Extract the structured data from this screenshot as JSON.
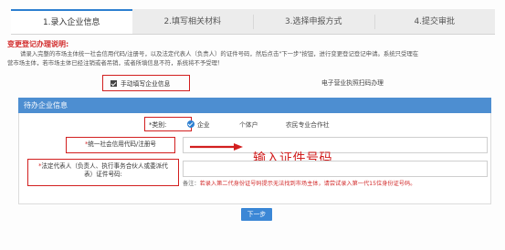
{
  "steps": [
    {
      "label": "1.录入企业信息",
      "active": true
    },
    {
      "label": "2.填写相关材料",
      "active": false
    },
    {
      "label": "3.选择申报方式",
      "active": false
    },
    {
      "label": "4.提交审批",
      "active": false
    }
  ],
  "notice": {
    "title": "变更登记办理说明:",
    "line1": "请录入完整的市场主体统一社会信用代码/注册号，以及法定代表人（负责人）的证件号码，然后点击\"下一步\"按钮，进行变更登记登记申请。系统只受理在",
    "line2": "营市场主体，若市场主体已经注销或者吊销，或者所填信息不符，系统将不予受理！"
  },
  "options": {
    "manual_label": "手动填写企业信息",
    "license_label": "电子营业执照扫码办理"
  },
  "section": {
    "title": "待办企业信息"
  },
  "form": {
    "type_label": "*类别:",
    "type_options": [
      "企业",
      "个体户",
      "农民专业合作社"
    ],
    "selected_type": "企业",
    "uscc_label": "统一社会信用代码/注册号",
    "uscc_value": "",
    "rep_label_line1": "法定代表人（负责人、执行事务合伙人或委派代",
    "rep_label_line2": "表）证件号码:",
    "rep_value": "",
    "note_prefix": "备注：",
    "note_text": "若录入第二代身份证号码提示无法找到市场主体，请尝试录入第一代15位身份证号码。"
  },
  "annotation": {
    "text": "输入证件号码"
  },
  "next_button": {
    "label": "下一步"
  },
  "colors": {
    "accent": "#2d7fd0",
    "highlight": "#d21f1f",
    "section_bar": "#4d8ed1"
  }
}
